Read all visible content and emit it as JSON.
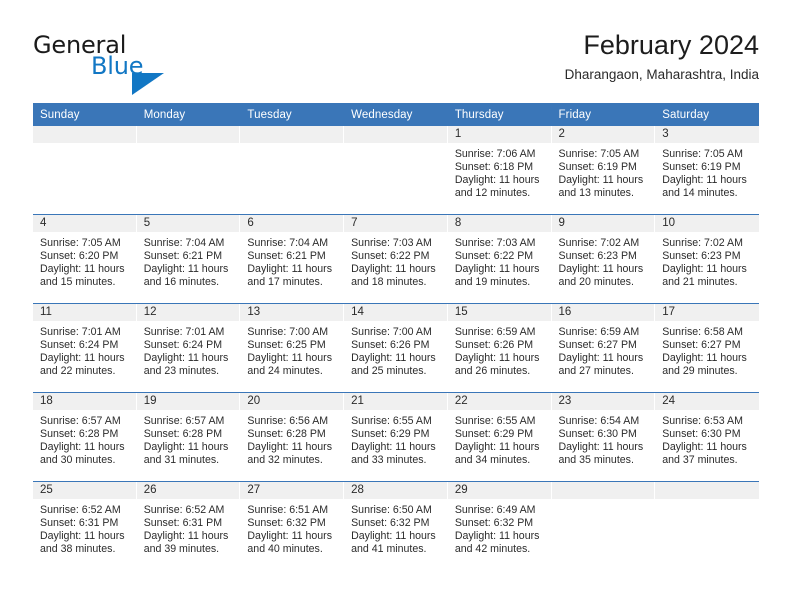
{
  "brand": {
    "name_part1": "General",
    "name_part2": "Blue",
    "triangle_color": "#1277c4"
  },
  "header": {
    "title": "February 2024",
    "subtitle": "Dharangaon, Maharashtra, India"
  },
  "theme": {
    "header_blue": "#3a76b8",
    "daynum_band": "#f0f0f0",
    "text": "#2b2b2b"
  },
  "weekday_headers": [
    "Sunday",
    "Monday",
    "Tuesday",
    "Wednesday",
    "Thursday",
    "Friday",
    "Saturday"
  ],
  "labels": {
    "sunrise_prefix": "Sunrise:",
    "sunset_prefix": "Sunset:",
    "daylight_prefix": "Daylight:"
  },
  "weeks": [
    [
      {
        "day": "",
        "sunrise": "",
        "sunset": "",
        "daylight": ""
      },
      {
        "day": "",
        "sunrise": "",
        "sunset": "",
        "daylight": ""
      },
      {
        "day": "",
        "sunrise": "",
        "sunset": "",
        "daylight": ""
      },
      {
        "day": "",
        "sunrise": "",
        "sunset": "",
        "daylight": ""
      },
      {
        "day": "1",
        "sunrise": "Sunrise: 7:06 AM",
        "sunset": "Sunset: 6:18 PM",
        "daylight": "Daylight: 11 hours and 12 minutes."
      },
      {
        "day": "2",
        "sunrise": "Sunrise: 7:05 AM",
        "sunset": "Sunset: 6:19 PM",
        "daylight": "Daylight: 11 hours and 13 minutes."
      },
      {
        "day": "3",
        "sunrise": "Sunrise: 7:05 AM",
        "sunset": "Sunset: 6:19 PM",
        "daylight": "Daylight: 11 hours and 14 minutes."
      }
    ],
    [
      {
        "day": "4",
        "sunrise": "Sunrise: 7:05 AM",
        "sunset": "Sunset: 6:20 PM",
        "daylight": "Daylight: 11 hours and 15 minutes."
      },
      {
        "day": "5",
        "sunrise": "Sunrise: 7:04 AM",
        "sunset": "Sunset: 6:21 PM",
        "daylight": "Daylight: 11 hours and 16 minutes."
      },
      {
        "day": "6",
        "sunrise": "Sunrise: 7:04 AM",
        "sunset": "Sunset: 6:21 PM",
        "daylight": "Daylight: 11 hours and 17 minutes."
      },
      {
        "day": "7",
        "sunrise": "Sunrise: 7:03 AM",
        "sunset": "Sunset: 6:22 PM",
        "daylight": "Daylight: 11 hours and 18 minutes."
      },
      {
        "day": "8",
        "sunrise": "Sunrise: 7:03 AM",
        "sunset": "Sunset: 6:22 PM",
        "daylight": "Daylight: 11 hours and 19 minutes."
      },
      {
        "day": "9",
        "sunrise": "Sunrise: 7:02 AM",
        "sunset": "Sunset: 6:23 PM",
        "daylight": "Daylight: 11 hours and 20 minutes."
      },
      {
        "day": "10",
        "sunrise": "Sunrise: 7:02 AM",
        "sunset": "Sunset: 6:23 PM",
        "daylight": "Daylight: 11 hours and 21 minutes."
      }
    ],
    [
      {
        "day": "11",
        "sunrise": "Sunrise: 7:01 AM",
        "sunset": "Sunset: 6:24 PM",
        "daylight": "Daylight: 11 hours and 22 minutes."
      },
      {
        "day": "12",
        "sunrise": "Sunrise: 7:01 AM",
        "sunset": "Sunset: 6:24 PM",
        "daylight": "Daylight: 11 hours and 23 minutes."
      },
      {
        "day": "13",
        "sunrise": "Sunrise: 7:00 AM",
        "sunset": "Sunset: 6:25 PM",
        "daylight": "Daylight: 11 hours and 24 minutes."
      },
      {
        "day": "14",
        "sunrise": "Sunrise: 7:00 AM",
        "sunset": "Sunset: 6:26 PM",
        "daylight": "Daylight: 11 hours and 25 minutes."
      },
      {
        "day": "15",
        "sunrise": "Sunrise: 6:59 AM",
        "sunset": "Sunset: 6:26 PM",
        "daylight": "Daylight: 11 hours and 26 minutes."
      },
      {
        "day": "16",
        "sunrise": "Sunrise: 6:59 AM",
        "sunset": "Sunset: 6:27 PM",
        "daylight": "Daylight: 11 hours and 27 minutes."
      },
      {
        "day": "17",
        "sunrise": "Sunrise: 6:58 AM",
        "sunset": "Sunset: 6:27 PM",
        "daylight": "Daylight: 11 hours and 29 minutes."
      }
    ],
    [
      {
        "day": "18",
        "sunrise": "Sunrise: 6:57 AM",
        "sunset": "Sunset: 6:28 PM",
        "daylight": "Daylight: 11 hours and 30 minutes."
      },
      {
        "day": "19",
        "sunrise": "Sunrise: 6:57 AM",
        "sunset": "Sunset: 6:28 PM",
        "daylight": "Daylight: 11 hours and 31 minutes."
      },
      {
        "day": "20",
        "sunrise": "Sunrise: 6:56 AM",
        "sunset": "Sunset: 6:28 PM",
        "daylight": "Daylight: 11 hours and 32 minutes."
      },
      {
        "day": "21",
        "sunrise": "Sunrise: 6:55 AM",
        "sunset": "Sunset: 6:29 PM",
        "daylight": "Daylight: 11 hours and 33 minutes."
      },
      {
        "day": "22",
        "sunrise": "Sunrise: 6:55 AM",
        "sunset": "Sunset: 6:29 PM",
        "daylight": "Daylight: 11 hours and 34 minutes."
      },
      {
        "day": "23",
        "sunrise": "Sunrise: 6:54 AM",
        "sunset": "Sunset: 6:30 PM",
        "daylight": "Daylight: 11 hours and 35 minutes."
      },
      {
        "day": "24",
        "sunrise": "Sunrise: 6:53 AM",
        "sunset": "Sunset: 6:30 PM",
        "daylight": "Daylight: 11 hours and 37 minutes."
      }
    ],
    [
      {
        "day": "25",
        "sunrise": "Sunrise: 6:52 AM",
        "sunset": "Sunset: 6:31 PM",
        "daylight": "Daylight: 11 hours and 38 minutes."
      },
      {
        "day": "26",
        "sunrise": "Sunrise: 6:52 AM",
        "sunset": "Sunset: 6:31 PM",
        "daylight": "Daylight: 11 hours and 39 minutes."
      },
      {
        "day": "27",
        "sunrise": "Sunrise: 6:51 AM",
        "sunset": "Sunset: 6:32 PM",
        "daylight": "Daylight: 11 hours and 40 minutes."
      },
      {
        "day": "28",
        "sunrise": "Sunrise: 6:50 AM",
        "sunset": "Sunset: 6:32 PM",
        "daylight": "Daylight: 11 hours and 41 minutes."
      },
      {
        "day": "29",
        "sunrise": "Sunrise: 6:49 AM",
        "sunset": "Sunset: 6:32 PM",
        "daylight": "Daylight: 11 hours and 42 minutes."
      },
      {
        "day": "",
        "sunrise": "",
        "sunset": "",
        "daylight": ""
      },
      {
        "day": "",
        "sunrise": "",
        "sunset": "",
        "daylight": ""
      }
    ]
  ]
}
